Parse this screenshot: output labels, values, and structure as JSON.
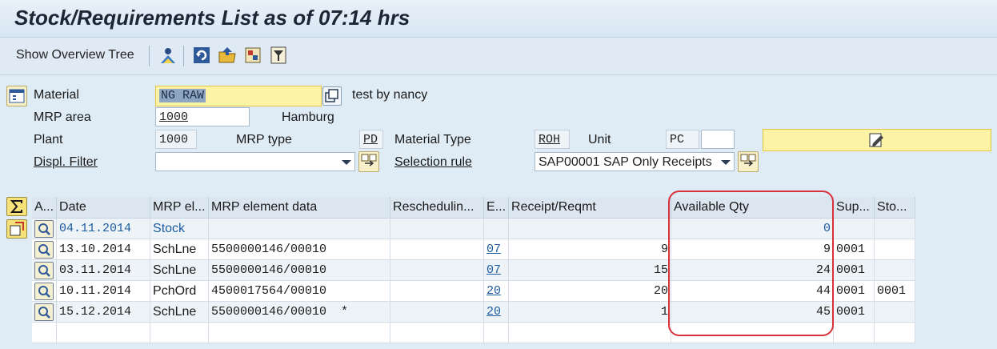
{
  "window": {
    "title": "Stock/Requirements List as of 07:14 hrs"
  },
  "toolbar": {
    "show_overview_tree": "Show Overview Tree",
    "icons": [
      "user-icon",
      "refresh-icon",
      "folder-icon",
      "settings-icon",
      "filter-icon"
    ]
  },
  "header": {
    "material_label": "Material",
    "material_value": "NG RAW",
    "material_desc": "test by nancy",
    "mrp_area_label": "MRP area",
    "mrp_area_value": "1000",
    "mrp_area_desc": "Hamburg",
    "plant_label": "Plant",
    "plant_value": "1000",
    "mrp_type_label": "MRP type",
    "mrp_type_value": "PD",
    "material_type_label": "Material Type",
    "material_type_value": "ROH",
    "unit_label": "Unit",
    "unit_value": "PC",
    "displ_filter_label": "Displ. Filter",
    "displ_filter_value": "",
    "selection_rule_label": "Selection rule",
    "selection_rule_value": "SAP00001 SAP Only Receipts"
  },
  "table": {
    "columns": [
      "A...",
      "Date",
      "MRP el...",
      "MRP element data",
      "Reschedulin...",
      "E...",
      "Receipt/Reqmt",
      "Available Qty",
      "Sup...",
      "Sto..."
    ],
    "rows": [
      {
        "date": "04.11.2014",
        "mrp_el": "Stock",
        "data": "",
        "resched": "",
        "e": "",
        "receipt": "",
        "avail": "0",
        "sup": "",
        "sto": ""
      },
      {
        "date": "13.10.2014",
        "mrp_el": "SchLne",
        "data": "5500000146/00010",
        "resched": "",
        "e": "07",
        "receipt": "9",
        "avail": "9",
        "sup": "0001",
        "sto": ""
      },
      {
        "date": "03.11.2014",
        "mrp_el": "SchLne",
        "data": "5500000146/00010",
        "resched": "",
        "e": "07",
        "receipt": "15",
        "avail": "24",
        "sup": "0001",
        "sto": ""
      },
      {
        "date": "10.11.2014",
        "mrp_el": "PchOrd",
        "data": "4500017564/00010",
        "resched": "",
        "e": "20",
        "receipt": "20",
        "avail": "44",
        "sup": "0001",
        "sto": "0001"
      },
      {
        "date": "15.12.2014",
        "mrp_el": "SchLne",
        "data": "5500000146/00010  *",
        "resched": "",
        "e": "20",
        "receipt": "1",
        "avail": "45",
        "sup": "0001",
        "sto": ""
      }
    ]
  },
  "colors": {
    "highlight": "#d8333a",
    "link": "#1c5b9e",
    "background": "#dfebf5"
  }
}
